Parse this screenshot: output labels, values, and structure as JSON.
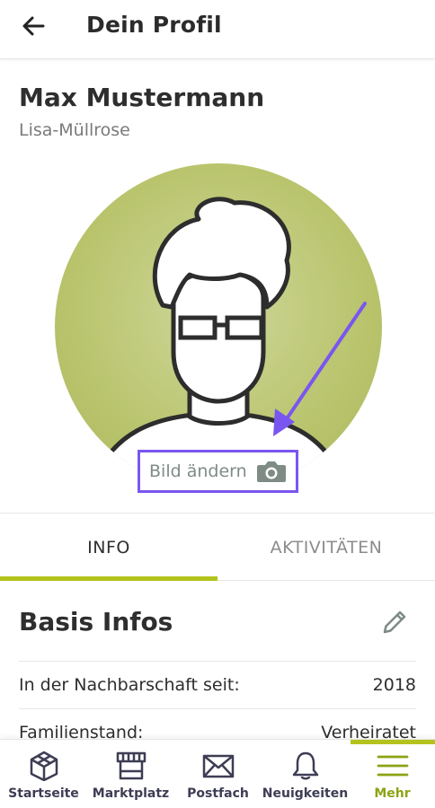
{
  "appbar": {
    "title": "Dein Profil",
    "back_icon": "arrow-left-icon"
  },
  "profile": {
    "name": "Max Mustermann",
    "place": "Lisa-Müllrose"
  },
  "avatar": {
    "change_label": "Bild ändern",
    "camera_icon": "camera-icon"
  },
  "tabs": [
    {
      "label": "INFO",
      "active": true
    },
    {
      "label": "AKTIVITÄTEN",
      "active": false
    }
  ],
  "basis": {
    "title": "Basis Infos",
    "edit_icon": "pencil-icon",
    "rows": [
      {
        "label": "In der Nachbarschaft seit:",
        "value": "2018"
      },
      {
        "label": "Familienstand:",
        "value": "Verheiratet"
      }
    ]
  },
  "nav": [
    {
      "label": "Startseite",
      "icon": "home-icon"
    },
    {
      "label": "Marktplatz",
      "icon": "market-stall-icon"
    },
    {
      "label": "Postfach",
      "icon": "mail-icon"
    },
    {
      "label": "Neuigkeiten",
      "icon": "bell-icon"
    },
    {
      "label": "Mehr",
      "icon": "menu-icon",
      "active": true
    }
  ],
  "colors": {
    "accent": "#b3c31c",
    "highlight": "#7a56f0",
    "avatar_bg": "#b9c46d"
  }
}
